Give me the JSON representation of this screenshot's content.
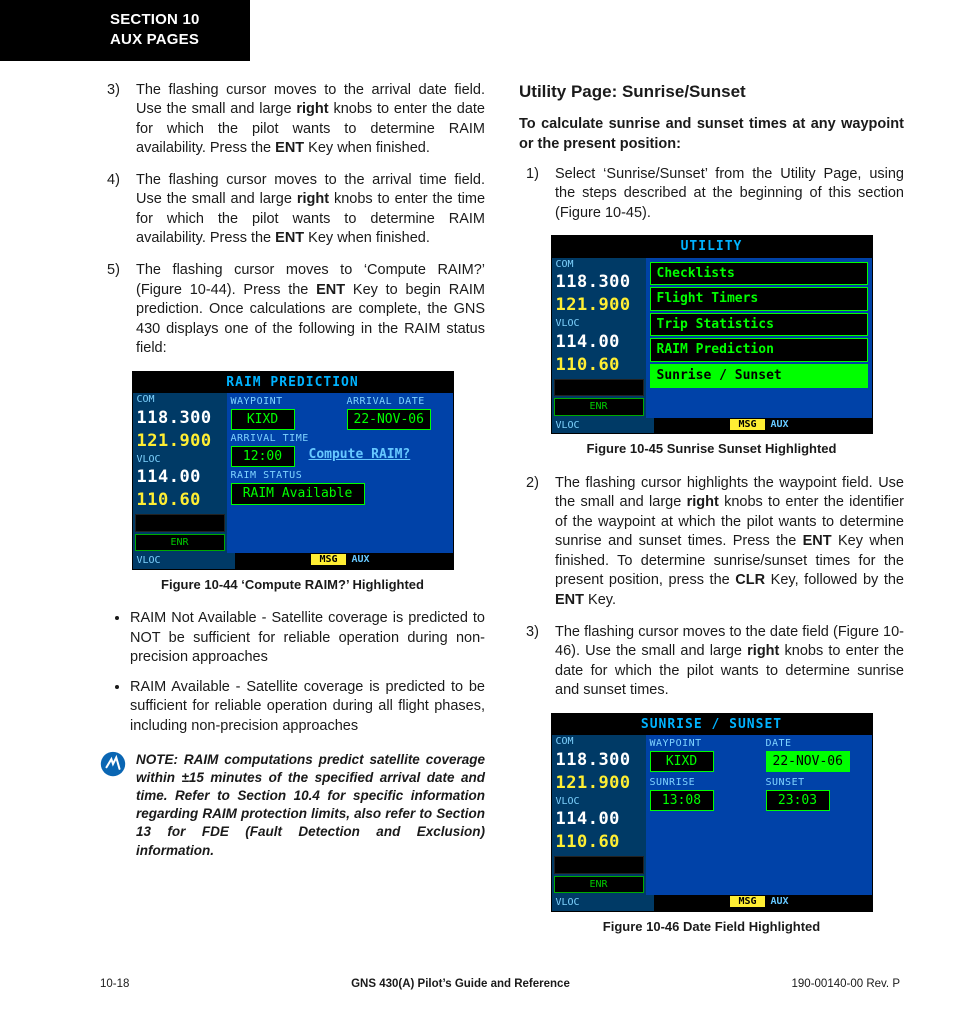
{
  "header": {
    "line1": "SECTION 10",
    "line2": "AUX PAGES"
  },
  "left": {
    "steps_start": 3,
    "steps": [
      "The flashing cursor moves to the arrival date field.  Use the small and large <strong>right</strong> knobs to enter the date for which the pilot wants to determine RAIM availability.  Press the <strong>ENT</strong> Key when finished.",
      "The flashing cursor moves to the arrival time field.  Use the small and large <strong>right</strong> knobs to enter the time for which the pilot wants to determine RAIM availability.  Press the <strong>ENT</strong> Key when finished.",
      "The flashing cursor moves to ‘Compute RAIM?’ (Figure 10-44).  Press the <strong>ENT</strong> Key to begin RAIM prediction.  Once calculations are complete, the GNS 430 displays one of the following in the RAIM status field:"
    ],
    "fig44_caption": "Figure 10-44  ‘Compute RAIM?’ Highlighted",
    "bullets": [
      "RAIM Not Available - Satellite coverage is predicted to NOT be sufficient for reliable operation during non-precision approaches",
      "RAIM Available - Satellite coverage is predicted to be sufficient for reliable operation during all flight phases, including non-precision approaches"
    ],
    "note": "NOTE:  RAIM computations predict satellite coverage within ±15 minutes of the specified arrival date and time.  Refer to Section 10.4 for specific information regarding RAIM protection limits, also refer to Section 13 for FDE (Fault Detection and Exclusion) information."
  },
  "right": {
    "heading": "Utility Page: Sunrise/Sunset",
    "lead": "To calculate sunrise and sunset times at any waypoint or the present position:",
    "steps_start": 1,
    "steps": [
      "Select ‘Sunrise/Sunset’ from the Utility Page, using the steps described at the beginning of this section (Figure 10-45).",
      "The flashing cursor highlights the waypoint field.  Use the small and large <strong>right</strong> knobs to enter the identifier of the waypoint at which the pilot wants to determine sunrise and sunset times.  Press the <strong>ENT</strong> Key when finished.  To determine sunrise/sunset times for the present position, press the <strong>CLR</strong> Key, followed by the <strong>ENT</strong> Key.",
      "The flashing cursor moves to the date field (Figure 10-46).  Use the small and large <strong>right</strong> knobs to enter the date for which the pilot wants to determine sunrise and sunset times."
    ],
    "fig45_caption": "Figure 10-45  Sunrise Sunset Highlighted",
    "fig46_caption": "Figure 10-46  Date Field Highlighted"
  },
  "device44": {
    "title": "RAIM PREDICTION",
    "com_lbl": "COM",
    "com1": "118.300",
    "com2": "121.900",
    "vloc_lbl": "VLOC",
    "vloc1": "114.00",
    "vloc2": "110.60",
    "enr": "ENR",
    "waypoint_lbl": "WAYPOINT",
    "waypoint": "KIXD",
    "arrdate_lbl": "ARRIVAL DATE",
    "arrdate": "22-NOV-06",
    "arrtime_lbl": "ARRIVAL TIME",
    "arrtime": "12:00",
    "compute": "Compute RAIM?",
    "status_lbl": "RAIM STATUS",
    "status": "RAIM Available",
    "vloc_bar": "VLOC",
    "msg": "MSG",
    "aux": "AUX"
  },
  "device45": {
    "title": "UTILITY",
    "com_lbl": "COM",
    "com1": "118.300",
    "com2": "121.900",
    "vloc_lbl": "VLOC",
    "vloc1": "114.00",
    "vloc2": "110.60",
    "enr": "ENR",
    "items": [
      "Checklists",
      "Flight Timers",
      "Trip Statistics",
      "RAIM Prediction",
      "Sunrise / Sunset"
    ],
    "vloc_bar": "VLOC",
    "msg": "MSG",
    "aux": "AUX"
  },
  "device46": {
    "title": "SUNRISE / SUNSET",
    "com_lbl": "COM",
    "com1": "118.300",
    "com2": "121.900",
    "vloc_lbl": "VLOC",
    "vloc1": "114.00",
    "vloc2": "110.60",
    "enr": "ENR",
    "waypoint_lbl": "WAYPOINT",
    "waypoint": "KIXD",
    "date_lbl": "DATE",
    "date": "22-NOV-06",
    "sunrise_lbl": "SUNRISE",
    "sunrise": "13:08",
    "sunset_lbl": "SUNSET",
    "sunset": "23:03",
    "vloc_bar": "VLOC",
    "msg": "MSG",
    "aux": "AUX"
  },
  "footer": {
    "left": "10-18",
    "mid": "GNS 430(A) Pilot’s Guide and Reference",
    "right": "190-00140-00  Rev. P"
  }
}
